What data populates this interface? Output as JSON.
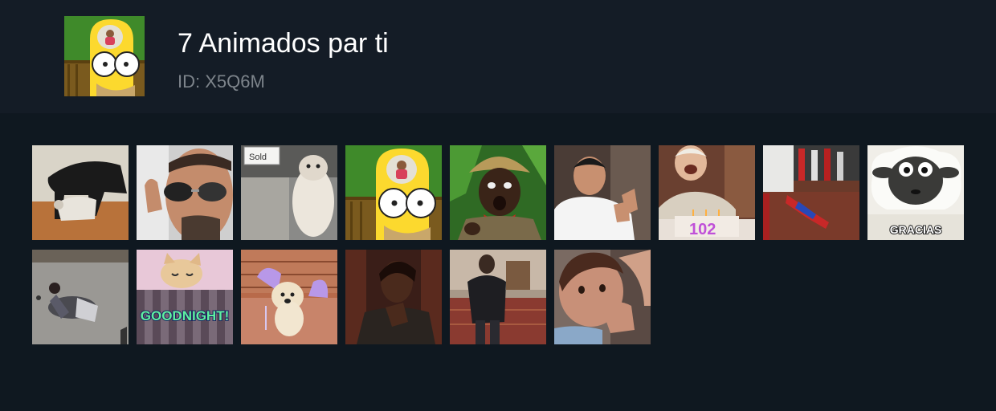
{
  "pack": {
    "title": "7 Animados par ti",
    "id_label": "ID: X5Q6M",
    "icon": "homer-simpson-sticker"
  },
  "stickers": [
    {
      "name": "sticker-dogs",
      "icon": "dogs-image"
    },
    {
      "name": "sticker-sunglasses-man",
      "icon": "sunglasses-man-image"
    },
    {
      "name": "sticker-sold-dog",
      "icon": "sold-sign-dog-image",
      "text": "Sold"
    },
    {
      "name": "sticker-homer",
      "icon": "homer-simpson-image"
    },
    {
      "name": "sticker-shocked-man",
      "icon": "shocked-man-hat-image"
    },
    {
      "name": "sticker-clapping-man",
      "icon": "clapping-man-image"
    },
    {
      "name": "sticker-birthday-grandma",
      "icon": "birthday-grandma-image",
      "text": "102"
    },
    {
      "name": "sticker-spiderman",
      "icon": "spiderman-floor-image"
    },
    {
      "name": "sticker-gracias-sheep",
      "icon": "sheep-gracias-image",
      "text": "GRACIAS"
    },
    {
      "name": "sticker-street-fall",
      "icon": "street-fall-image"
    },
    {
      "name": "sticker-goodnight-kitten",
      "icon": "goodnight-kitten-image",
      "text": "GOODNIGHT!"
    },
    {
      "name": "sticker-fairy-puppy",
      "icon": "fairy-puppy-image"
    },
    {
      "name": "sticker-thinking-man",
      "icon": "thinking-man-image"
    },
    {
      "name": "sticker-walking-man",
      "icon": "walking-man-image"
    },
    {
      "name": "sticker-baby",
      "icon": "baby-image"
    }
  ],
  "colors": {
    "header_bg": "#141c26",
    "page_bg": "#0f1820",
    "title": "#ffffff",
    "id_text": "#7d848b"
  }
}
